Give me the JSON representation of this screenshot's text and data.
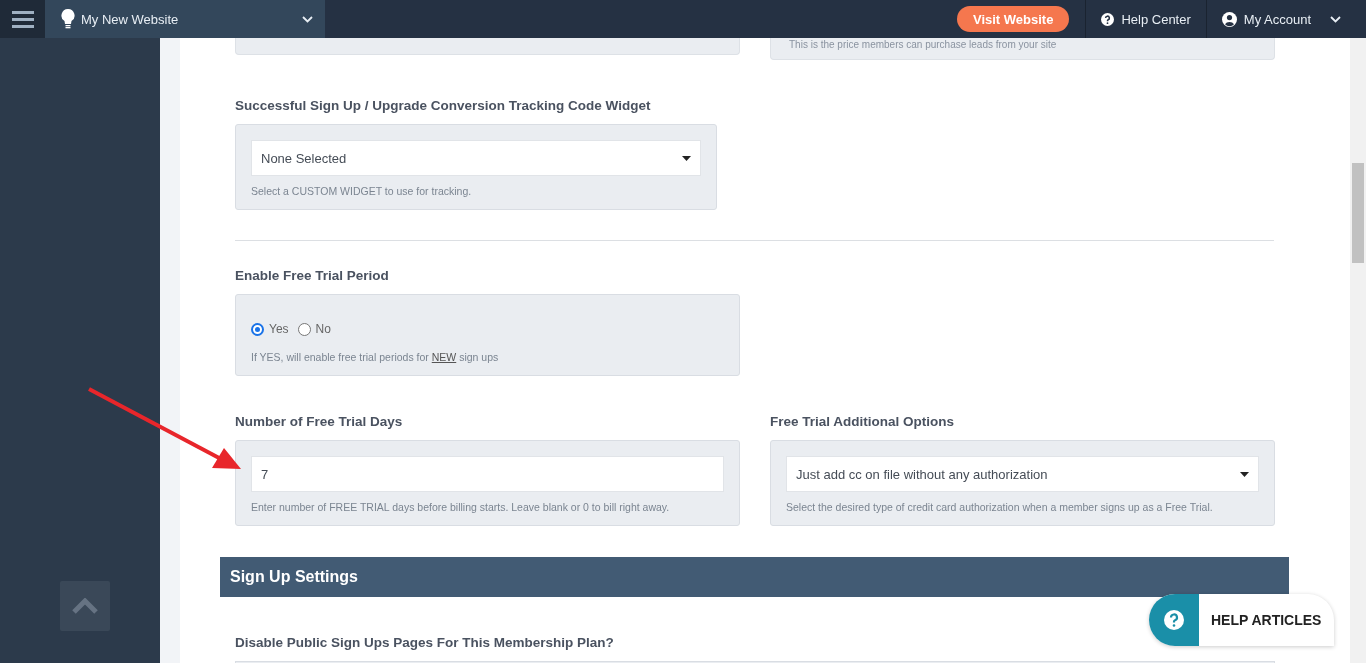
{
  "header": {
    "site_name": "My New Website",
    "visit_button": "Visit Website",
    "help_center": "Help Center",
    "account": "My Account"
  },
  "partial_hint": "This is the price members can purchase leads from your site",
  "rows": [
    {
      "kind": "fields",
      "fields": [
        {
          "kind": "select",
          "label": "Successful Sign Up / Upgrade Conversion Tracking Code Widget",
          "value": "None Selected",
          "hint": "Select a CUSTOM WIDGET to use for tracking."
        }
      ]
    },
    {
      "kind": "divider"
    },
    {
      "kind": "fields",
      "fields": [
        {
          "kind": "radio",
          "label": "Enable Free Trial Period",
          "options": [
            {
              "label": "Yes",
              "selected": true
            },
            {
              "label": "No",
              "selected": false
            }
          ],
          "hint": "If YES, will enable free trial periods for ",
          "hint_link": "NEW",
          "hint_end": " sign ups"
        }
      ]
    },
    {
      "kind": "fields",
      "fields": [
        {
          "kind": "text",
          "label": "Number of Free Trial Days",
          "value": "7",
          "hint": "Enter number of FREE TRIAL days before billing starts. Leave blank or 0 to bill right away."
        },
        {
          "kind": "select",
          "label": "Free Trial Additional Options",
          "value": "Just add cc on file without any authorization",
          "hint": "Select the desired type of credit card authorization when a member signs up as a Free Trial."
        }
      ]
    },
    {
      "kind": "section",
      "title": "Sign Up Settings"
    },
    {
      "kind": "fields",
      "fields": [
        {
          "kind": "cut",
          "label": "Disable Public Sign Ups Pages For This Membership Plan?"
        }
      ]
    }
  ],
  "help_button": "HELP ARTICLES"
}
